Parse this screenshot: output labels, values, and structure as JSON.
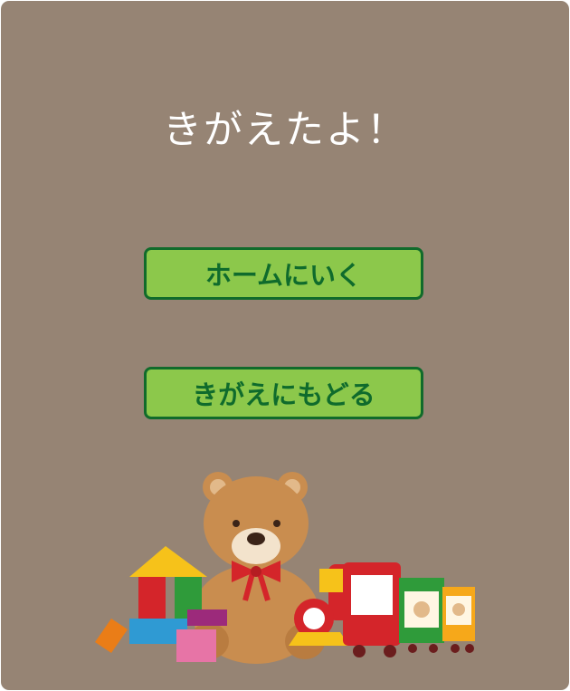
{
  "screen": {
    "title": "きがえたよ！"
  },
  "buttons": {
    "home_label": "ホームにいく",
    "back_label": "きがえにもどる"
  },
  "colors": {
    "background": "#968474",
    "button_fill": "#8cc84b",
    "button_border": "#106b2b",
    "button_text": "#0f6b2c",
    "title_text": "#ffffff"
  },
  "illustration": {
    "subject": "teddy bear with toy blocks and toy train"
  }
}
